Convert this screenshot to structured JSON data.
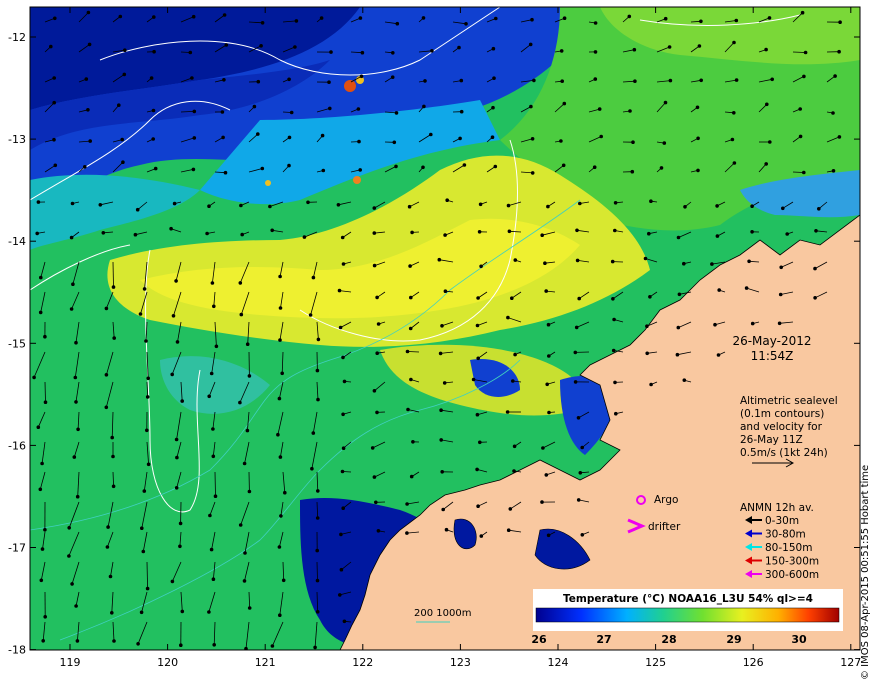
{
  "map": {
    "x_ticks": [
      "119",
      "120",
      "121",
      "122",
      "123",
      "124",
      "125",
      "126",
      "127"
    ],
    "y_ticks": [
      "-12",
      "-13",
      "-14",
      "-15",
      "-16",
      "-17",
      "-18"
    ],
    "date": "26-May-2012",
    "time": "11:54Z",
    "altimetric_note": [
      "Altimetric sealevel",
      "(0.1m contours)",
      "and velocity for",
      "26-May 11Z",
      "0.5m/s (1kt 24h)"
    ],
    "argo_label": "Argo",
    "drifter_label": "drifter",
    "anmn_title": "ANMN 12h av.",
    "anmn_items": [
      {
        "label": "0-30m",
        "color": "#000000"
      },
      {
        "label": "30-80m",
        "color": "#0000cc"
      },
      {
        "label": "80-150m",
        "color": "#00e5e5"
      },
      {
        "label": "150-300m",
        "color": "#dd0000"
      },
      {
        "label": "300-600m",
        "color": "#ee00ee"
      }
    ],
    "scale_label": "200  1000m",
    "colorbar_title": "Temperature (°C) NOAA16_L3U 54% ql>=4",
    "colorbar_ticks": [
      "26",
      "27",
      "28",
      "29",
      "30"
    ],
    "credit": "© IMOS 08-Apr-2015 00:51:55 Hobart time",
    "colors": {
      "land": "#f9c8a0",
      "argo": "#ee00ee",
      "drifter": "#ee00ee",
      "contour": "#ffffff",
      "bathy": "#40d0c0"
    }
  }
}
